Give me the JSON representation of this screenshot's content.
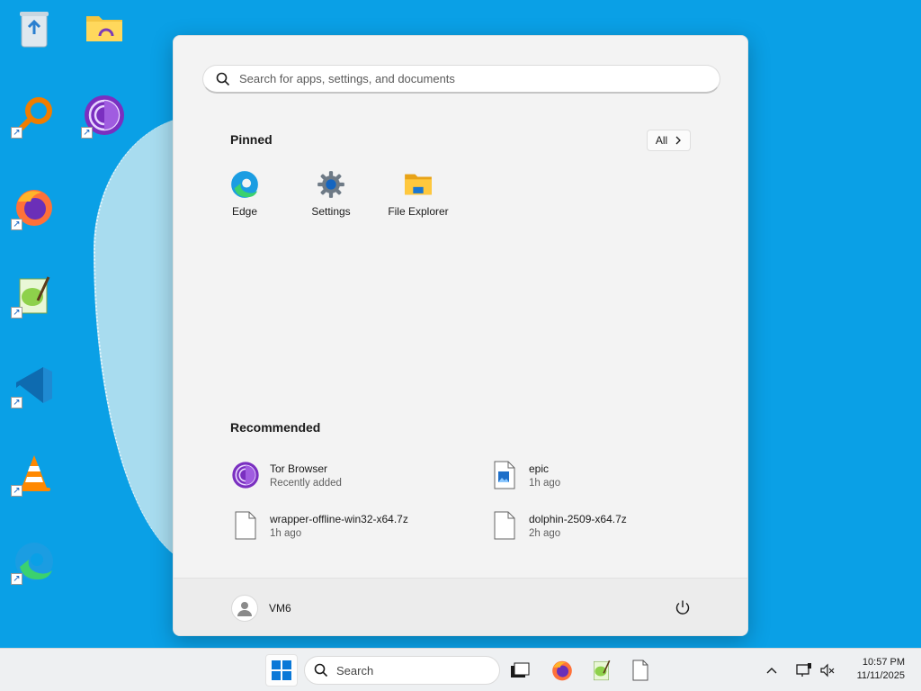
{
  "start_menu": {
    "search_placeholder": "Search for apps, settings, and documents",
    "pinned_title": "Pinned",
    "all_label": "All",
    "pinned": [
      {
        "label": "Edge",
        "icon": "edge-icon"
      },
      {
        "label": "Settings",
        "icon": "settings-gear-icon"
      },
      {
        "label": "File Explorer",
        "icon": "folder-icon"
      }
    ],
    "recommended_title": "Recommended",
    "recommended": [
      {
        "name": "Tor Browser",
        "sub": "Recently added",
        "icon": "tor-browser-icon"
      },
      {
        "name": "epic",
        "sub": "1h ago",
        "icon": "image-file-icon"
      },
      {
        "name": "wrapper-offline-win32-x64.7z",
        "sub": "1h ago",
        "icon": "file-icon"
      },
      {
        "name": "dolphin-2509-x64.7z",
        "sub": "2h ago",
        "icon": "file-icon"
      }
    ],
    "user_name": "VM6"
  },
  "taskbar": {
    "search_label": "Search",
    "time": "10:57 PM",
    "date": "11/11/2025"
  },
  "colors": {
    "desktop_bg": "#0aa0e6",
    "menu_bg": "#f3f3f3",
    "accent": "#0067c0"
  }
}
